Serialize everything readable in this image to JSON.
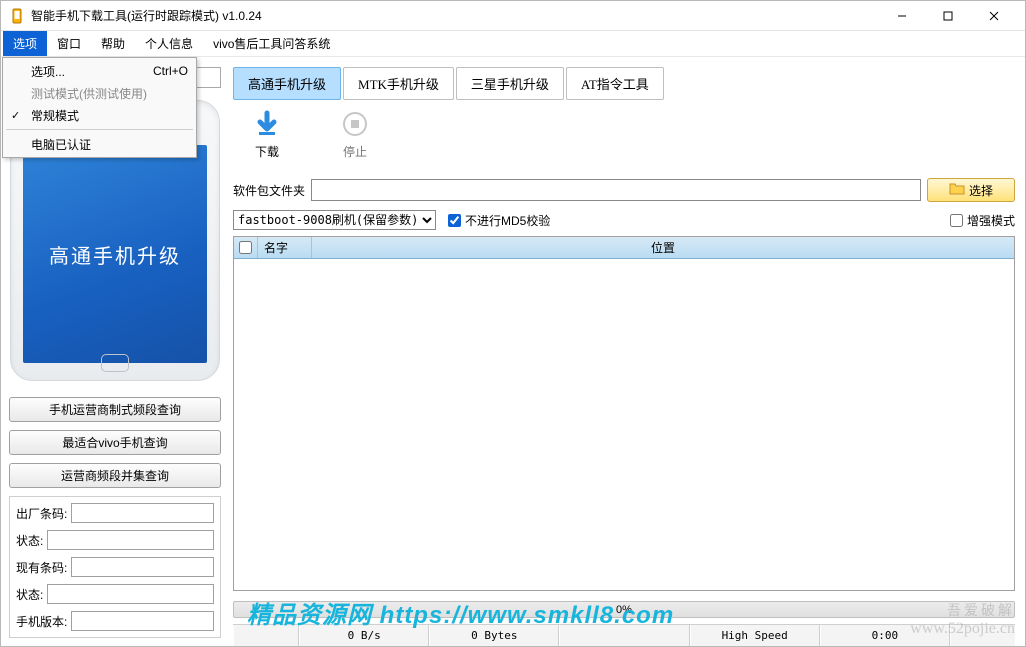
{
  "window": {
    "title": "智能手机下载工具(运行时跟踪模式)  v1.0.24"
  },
  "menubar": {
    "items": [
      "选项",
      "窗口",
      "帮助",
      "个人信息",
      "vivo售后工具问答系统"
    ],
    "active_index": 0
  },
  "dropdown": {
    "items": [
      {
        "label": "选项...",
        "shortcut": "Ctrl+O",
        "enabled": true,
        "checked": false
      },
      {
        "label": "测试模式(供测试使用)",
        "shortcut": "",
        "enabled": false,
        "checked": false
      },
      {
        "label": "常规模式",
        "shortcut": "",
        "enabled": true,
        "checked": true
      },
      {
        "label": "电脑已认证",
        "shortcut": "",
        "enabled": true,
        "checked": false
      }
    ]
  },
  "sidebar": {
    "phone_text": "高通手机升级",
    "buttons": [
      "手机运营商制式频段查询",
      "最适合vivo手机查询",
      "运营商频段并集查询"
    ],
    "form_labels": {
      "factory_barcode": "出厂条码:",
      "status1": "状态:",
      "current_barcode": "现有条码:",
      "status2": "状态:",
      "phone_version": "手机版本:"
    },
    "form_values": {
      "factory_barcode": "",
      "status1": "",
      "current_barcode": "",
      "status2": "",
      "phone_version": ""
    }
  },
  "tabs": [
    "高通手机升级",
    "MTK手机升级",
    "三星手机升级",
    "AT指令工具"
  ],
  "toolbar": {
    "download": "下载",
    "stop": "停止"
  },
  "path": {
    "label": "软件包文件夹",
    "value": "",
    "browse": "选择"
  },
  "options": {
    "mode_select": "fastboot-9008刷机(保留参数)",
    "skip_md5": "不进行MD5校验",
    "skip_md5_checked": true,
    "enhance": "增强模式",
    "enhance_checked": false
  },
  "table": {
    "cols": {
      "name": "名字",
      "location": "位置"
    }
  },
  "progress": {
    "percent": "0%"
  },
  "status": {
    "speed": "0 B/s",
    "bytes": "0 Bytes",
    "mode": "High Speed",
    "time": "0:00"
  },
  "watermark": {
    "big": "精品资源网  https://www.smkll8.com",
    "small_top": "吾爱破解",
    "small_bottom": "www.52pojie.cn"
  }
}
